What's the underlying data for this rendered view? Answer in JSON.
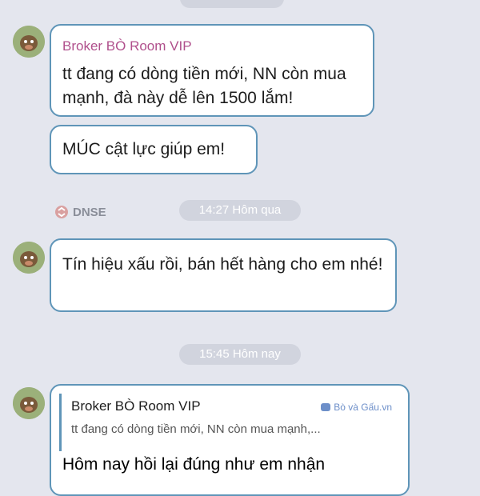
{
  "messages": [
    {
      "sender": "Broker BÒ Room VIP",
      "text": "tt đang có dòng tiền mới, NN còn mua mạnh, đà này dễ lên 1500 lắm!"
    },
    {
      "text": "MÚC cật lực giúp em!"
    },
    {
      "text": "Tín hiệu xấu rồi, bán hết hàng cho em nhé!"
    }
  ],
  "dnse_label": "DNSE",
  "time_separators": [
    "14:27 Hôm qua",
    "15:45 Hôm nay"
  ],
  "reply": {
    "quoted_sender": "Broker BÒ Room VIP",
    "quoted_text": "tt đang có dòng tiền mới, NN còn mua mạnh,...",
    "text": "Hôm nay hồi lại đúng như em nhận"
  },
  "watermark": "Bò và Gấu.vn",
  "colors": {
    "accent_border": "#5f95b8",
    "sender_name": "#b0508c",
    "background": "#e4e6ee"
  }
}
